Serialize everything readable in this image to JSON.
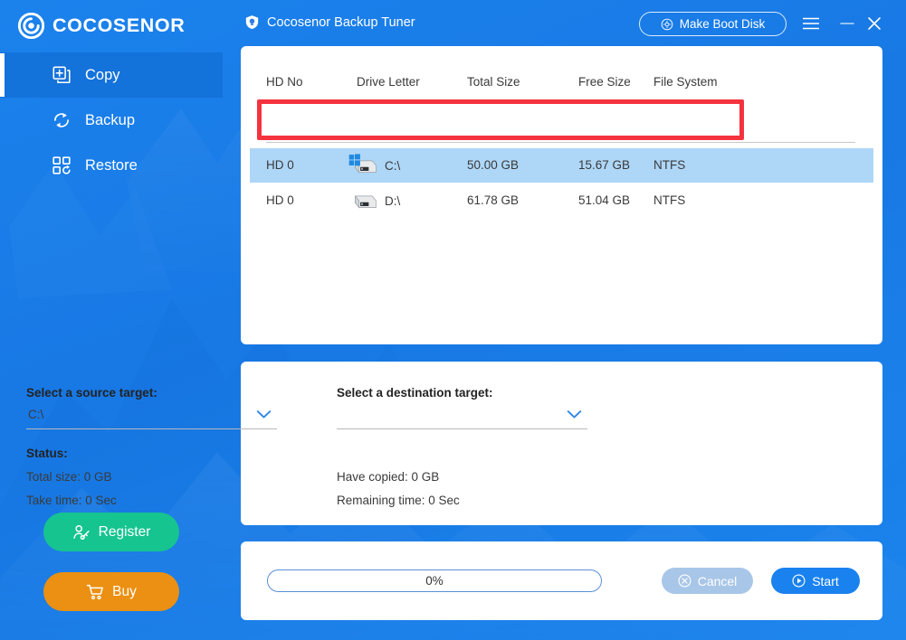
{
  "brand": {
    "name": "COCOSENOR",
    "logo_icon": "cocosenor-target-logo"
  },
  "sidebar": {
    "items": [
      {
        "label": "Copy",
        "icon": "copy-plus-icon",
        "active": true
      },
      {
        "label": "Backup",
        "icon": "refresh-cycle-icon",
        "active": false
      },
      {
        "label": "Restore",
        "icon": "restore-grid-icon",
        "active": false
      }
    ],
    "actions": {
      "register_label": "Register",
      "register_icon": "user-key-icon",
      "register_color": "#16c490",
      "buy_label": "Buy",
      "buy_icon": "shopping-cart-icon",
      "buy_color": "#eb9012"
    }
  },
  "titlebar": {
    "app_icon": "shield-icon",
    "title": "Cocosenor Backup Tuner",
    "make_boot_disk_label": "Make Boot Disk",
    "make_boot_disk_icon": "disc-icon",
    "menu_icon": "hamburger-menu-icon",
    "minimize_icon": "minimize-icon",
    "close_icon": "close-icon"
  },
  "drive_table": {
    "columns": [
      "HD No",
      "Drive Letter",
      "Total Size",
      "Free Size",
      "File System"
    ],
    "rows": [
      {
        "hd_no": "HD 0",
        "drive_letter": "C:\\",
        "total_size": "50.00 GB",
        "free_size": "15.67 GB",
        "file_system": "NTFS",
        "icon": "windows-system-drive-icon",
        "selected": true
      },
      {
        "hd_no": "HD 0",
        "drive_letter": "D:\\",
        "total_size": "61.78 GB",
        "free_size": "51.04 GB",
        "file_system": "NTFS",
        "icon": "hard-drive-icon",
        "selected": false
      }
    ],
    "selection_highlight_color": "#aed6f7",
    "annotation_box_color": "#f5333f"
  },
  "config": {
    "source_label": "Select a source target:",
    "source_value": "C:\\",
    "destination_label": "Select a destination target:",
    "destination_value": "",
    "status_label": "Status:",
    "total_size": "Total size:  0 GB",
    "take_time": "Take time:  0 Sec",
    "have_copied": "Have  copied:  0 GB",
    "remaining_time": "Remaining time:  0 Sec",
    "chevron_icon": "chevron-down-icon"
  },
  "actions": {
    "progress_text": "0%",
    "progress_percent": 0,
    "cancel_label": "Cancel",
    "cancel_icon": "cancel-circle-icon",
    "cancel_enabled": false,
    "start_label": "Start",
    "start_icon": "play-circle-icon",
    "start_color": "#1a82ee"
  }
}
